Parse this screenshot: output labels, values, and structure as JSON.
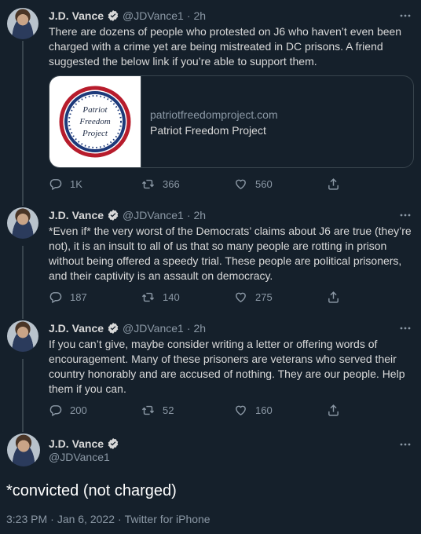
{
  "colors": {
    "background": "#15202b",
    "verified": "#d9d9d9",
    "muted": "#8b98a5"
  },
  "tweets": [
    {
      "name": "J.D. Vance",
      "handle": "@JDVance1",
      "sep": "·",
      "time": "2h",
      "text": "There are dozens of people who protested on J6 who haven’t even been charged with a crime yet are being mistreated in DC prisons. A friend suggested the below link if you’re able to support them.",
      "card": {
        "logo_lines": [
          "Patriot",
          "Freedom",
          "Project"
        ],
        "domain": "patriotfreedomproject.com",
        "title": "Patriot Freedom Project"
      },
      "replies": "1K",
      "retweets": "366",
      "likes": "560"
    },
    {
      "name": "J.D. Vance",
      "handle": "@JDVance1",
      "sep": "·",
      "time": "2h",
      "text": "*Even if* the very worst of the Democrats’ claims about J6 are true (they’re not), it is an insult to all of us that so many people are rotting in prison without being offered a speedy trial. These people are political prisoners, and their captivity is an assault on democracy.",
      "replies": "187",
      "retweets": "140",
      "likes": "275"
    },
    {
      "name": "J.D. Vance",
      "handle": "@JDVance1",
      "sep": "·",
      "time": "2h",
      "text": "If you can’t give, maybe consider writing a letter or offering words of encouragement. Many of these prisoners are veterans who served their country honorably and are accused of nothing. They are our people. Help them if you can.",
      "replies": "200",
      "retweets": "52",
      "likes": "160"
    }
  ],
  "main_tweet": {
    "name": "J.D. Vance",
    "handle": "@JDVance1",
    "text": "*convicted (not charged)",
    "time": "3:23 PM",
    "sep1": "·",
    "date": "Jan 6, 2022",
    "sep2": "·",
    "source": "Twitter for iPhone"
  }
}
